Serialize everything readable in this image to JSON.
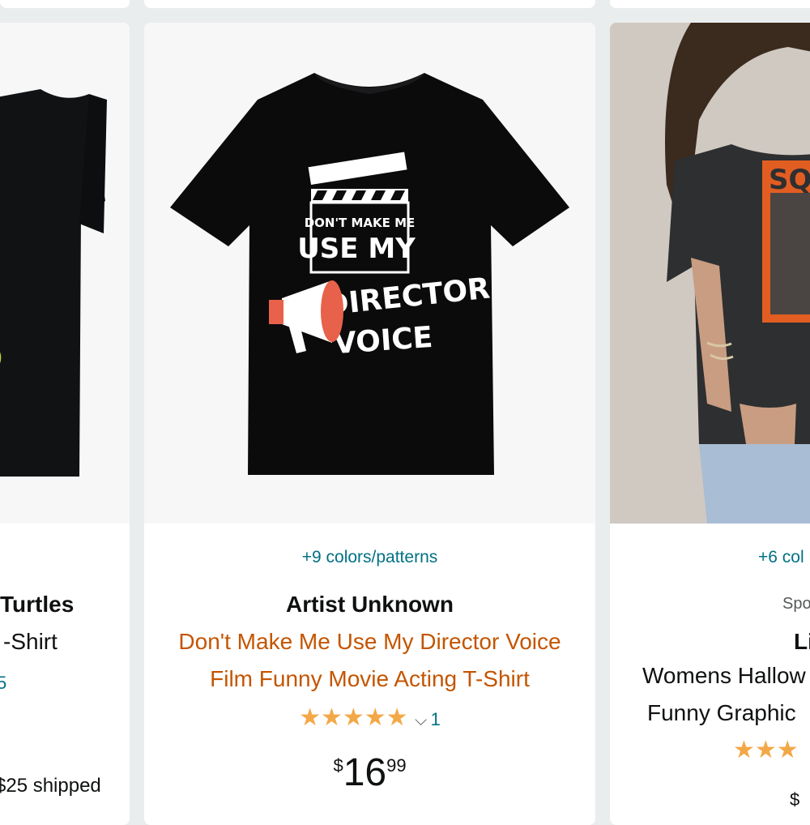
{
  "cards": [
    {
      "title_lines": [
        "Turtles",
        "-Shirt"
      ],
      "rating_partial": "5",
      "shipping": "$25 shipped"
    },
    {
      "colors": "+9 colors/patterns",
      "brand": "Artist Unknown",
      "title_lines": [
        "Don't Make Me Use My Director Voice",
        "Film Funny Movie Acting T-Shirt"
      ],
      "rating": {
        "stars": 5,
        "stars_glyph": "★★★★★",
        "count": "1",
        "chevron": "⌵"
      },
      "price": {
        "symbol": "$",
        "whole": "16",
        "fraction": "99"
      },
      "shirt_text": {
        "line1": "DON'T MAKE ME",
        "line2": "USE MY",
        "line3": "DIRECTOR",
        "line4": "VOICE"
      }
    },
    {
      "colors": "+6 col",
      "brand": "Spo",
      "title_lines": [
        "Li",
        "Womens Hallow",
        "Funny Graphic"
      ],
      "rating": {
        "stars_glyph": "★★★"
      },
      "price": {
        "symbol": "$"
      },
      "shirt_text": "SQ"
    }
  ],
  "colors": {
    "link": "#007185",
    "title_orange": "#c45500",
    "star": "#f3a847",
    "text": "#0f1111"
  }
}
